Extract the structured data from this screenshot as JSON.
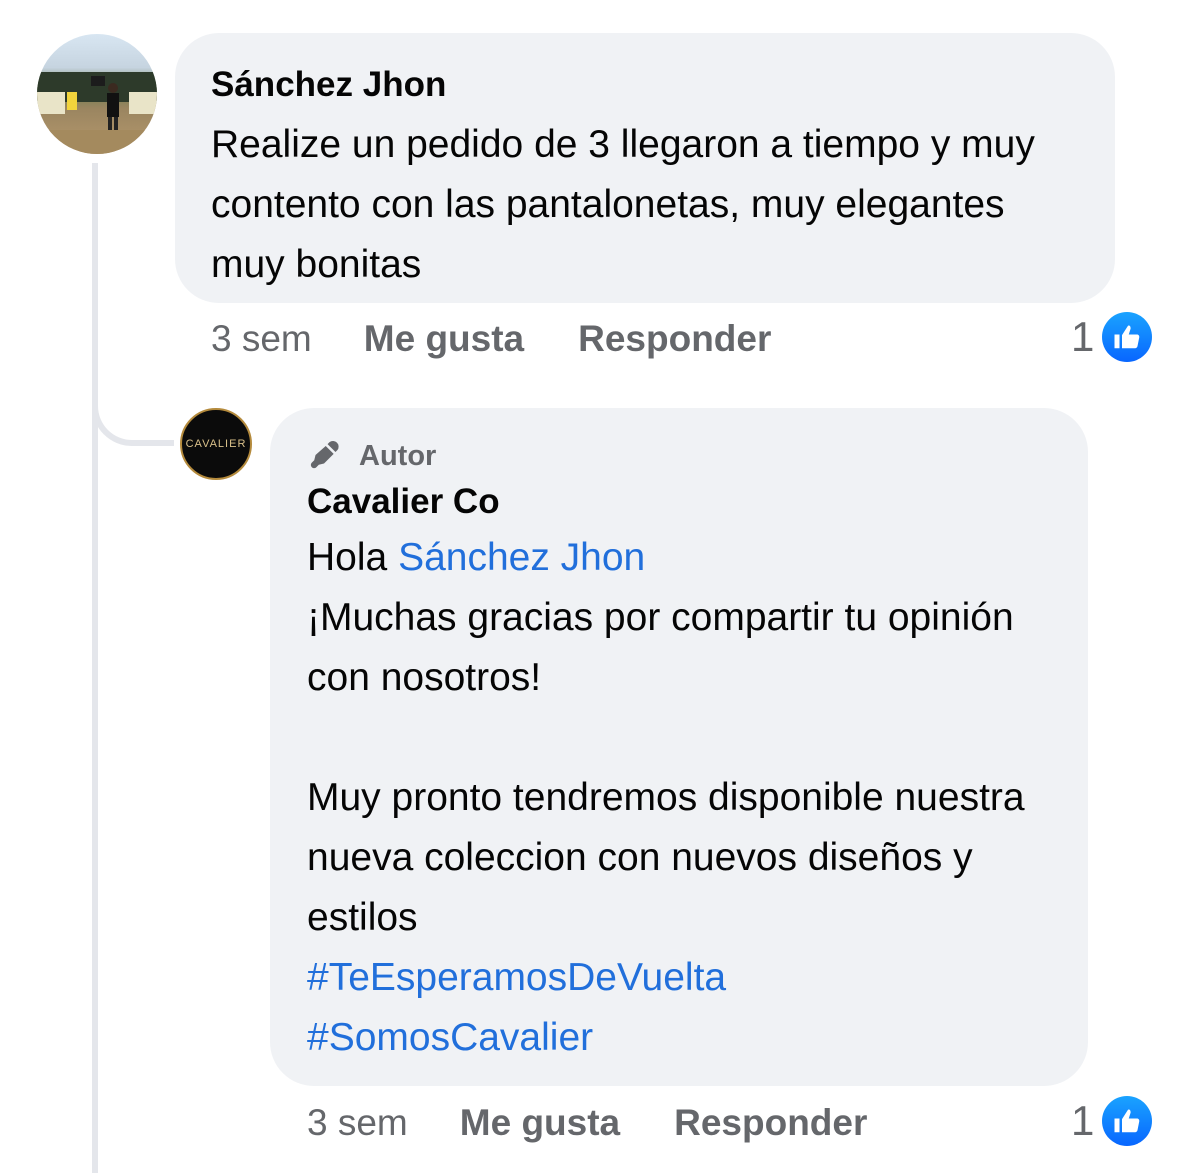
{
  "comment": {
    "author": "Sánchez Jhon",
    "text": "Realize un pedido de 3 llegaron a tiempo y muy contento con las pantalonetas, muy elegantes muy bonitas",
    "time": "3 sem",
    "like_label": "Me gusta",
    "reply_label": "Responder",
    "reaction_count": "1",
    "avatar_icon": "user-photo-avatar"
  },
  "reply": {
    "badge_label": "Autor",
    "badge_icon": "microphone-pen-icon",
    "author": "Cavalier Co",
    "avatar_text": "CAVALIER",
    "greeting": "Hola",
    "mention": "Sánchez Jhon",
    "paragraph1": "¡Muchas gracias por compartir tu opinión con nosotros!",
    "paragraph2": "Muy pronto tendremos disponible nuestra nueva coleccion con nuevos diseños y estilos",
    "hashtags": [
      "#TeEsperamosDeVuelta",
      "#SomosCavalier"
    ],
    "time": "3 sem",
    "like_label": "Me gusta",
    "reply_label": "Responder",
    "reaction_count": "1"
  },
  "colors": {
    "bubble_bg": "#f0f2f5",
    "link": "#216fdb",
    "meta_text": "#65676b",
    "like_blue": "#0866ff"
  }
}
